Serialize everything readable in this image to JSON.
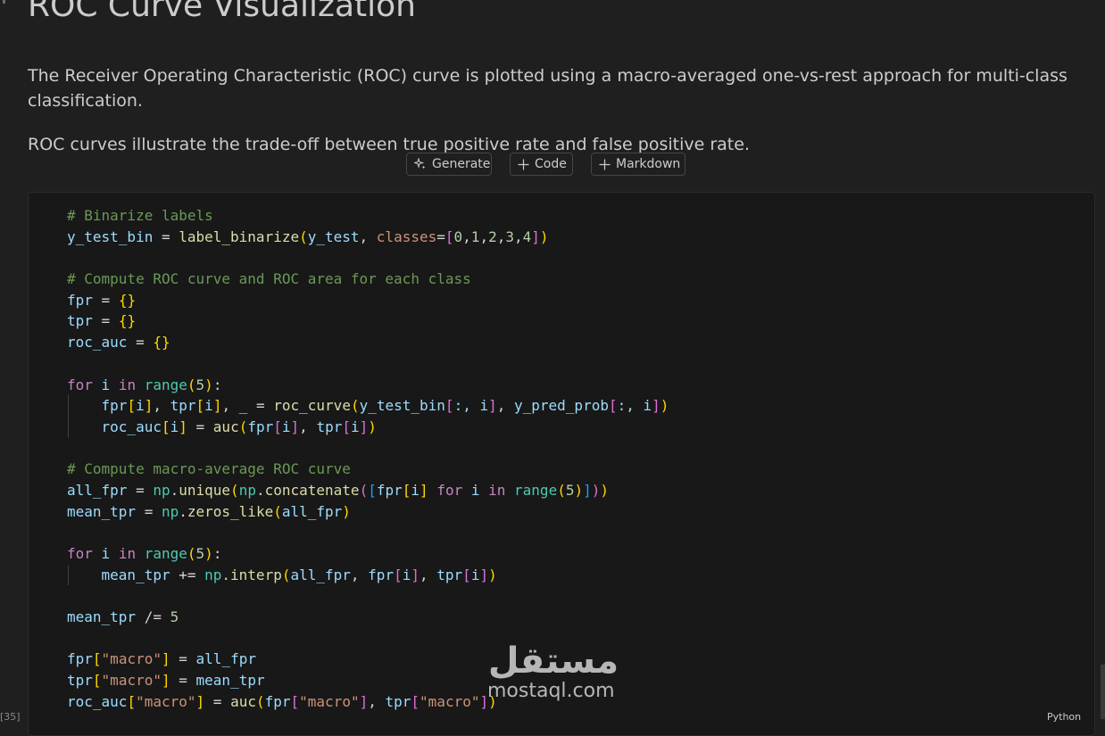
{
  "markdown": {
    "title": "ROC Curve Visualization",
    "paragraph1": "The Receiver Operating Characteristic (ROC) curve is plotted using a macro-averaged one-vs-rest approach for multi-class classification.",
    "paragraph2": "ROC curves illustrate the trade-off between true positive rate and false positive rate."
  },
  "toolbar": {
    "generate_label": "Generate",
    "code_label": "Code",
    "markdown_label": "Markdown"
  },
  "code_cell": {
    "execution_count": "[35]",
    "language": "Python",
    "lines": [
      {
        "indent": 0,
        "tokens": [
          {
            "t": "# Binarize labels",
            "c": "cm"
          }
        ]
      },
      {
        "indent": 0,
        "tokens": [
          {
            "t": "y_test_bin",
            "c": "vr"
          },
          {
            "t": " = ",
            "c": "op"
          },
          {
            "t": "label_binarize",
            "c": "fn"
          },
          {
            "t": "(",
            "c": "b1"
          },
          {
            "t": "y_test",
            "c": "vr"
          },
          {
            "t": ", ",
            "c": "op"
          },
          {
            "t": "classes",
            "c": "st"
          },
          {
            "t": "=",
            "c": "op"
          },
          {
            "t": "[",
            "c": "b2"
          },
          {
            "t": "0",
            "c": "nm"
          },
          {
            "t": ",",
            "c": "op"
          },
          {
            "t": "1",
            "c": "nm"
          },
          {
            "t": ",",
            "c": "op"
          },
          {
            "t": "2",
            "c": "nm"
          },
          {
            "t": ",",
            "c": "op"
          },
          {
            "t": "3",
            "c": "nm"
          },
          {
            "t": ",",
            "c": "op"
          },
          {
            "t": "4",
            "c": "nm"
          },
          {
            "t": "]",
            "c": "b2"
          },
          {
            "t": ")",
            "c": "b1"
          }
        ]
      },
      {
        "indent": 0,
        "tokens": []
      },
      {
        "indent": 0,
        "tokens": [
          {
            "t": "# Compute ROC curve and ROC area for each class",
            "c": "cm"
          }
        ]
      },
      {
        "indent": 0,
        "tokens": [
          {
            "t": "fpr",
            "c": "vr"
          },
          {
            "t": " = ",
            "c": "op"
          },
          {
            "t": "{}",
            "c": "b1"
          }
        ]
      },
      {
        "indent": 0,
        "tokens": [
          {
            "t": "tpr",
            "c": "vr"
          },
          {
            "t": " = ",
            "c": "op"
          },
          {
            "t": "{}",
            "c": "b1"
          }
        ]
      },
      {
        "indent": 0,
        "tokens": [
          {
            "t": "roc_auc",
            "c": "vr"
          },
          {
            "t": " = ",
            "c": "op"
          },
          {
            "t": "{}",
            "c": "b1"
          }
        ]
      },
      {
        "indent": 0,
        "tokens": []
      },
      {
        "indent": 0,
        "tokens": [
          {
            "t": "for",
            "c": "kw"
          },
          {
            "t": " i ",
            "c": "vr"
          },
          {
            "t": "in",
            "c": "kw"
          },
          {
            "t": " ",
            "c": "op"
          },
          {
            "t": "range",
            "c": "bi"
          },
          {
            "t": "(",
            "c": "b1"
          },
          {
            "t": "5",
            "c": "nm"
          },
          {
            "t": ")",
            "c": "b1"
          },
          {
            "t": ":",
            "c": "op"
          }
        ]
      },
      {
        "indent": 1,
        "tokens": [
          {
            "t": "fpr",
            "c": "vr"
          },
          {
            "t": "[",
            "c": "b1"
          },
          {
            "t": "i",
            "c": "vr"
          },
          {
            "t": "]",
            "c": "b1"
          },
          {
            "t": ", ",
            "c": "op"
          },
          {
            "t": "tpr",
            "c": "vr"
          },
          {
            "t": "[",
            "c": "b1"
          },
          {
            "t": "i",
            "c": "vr"
          },
          {
            "t": "]",
            "c": "b1"
          },
          {
            "t": ", _ = ",
            "c": "op"
          },
          {
            "t": "roc_curve",
            "c": "fn"
          },
          {
            "t": "(",
            "c": "b1"
          },
          {
            "t": "y_test_bin",
            "c": "vr"
          },
          {
            "t": "[",
            "c": "b2"
          },
          {
            "t": ":, i",
            "c": "vr"
          },
          {
            "t": "]",
            "c": "b2"
          },
          {
            "t": ", ",
            "c": "op"
          },
          {
            "t": "y_pred_prob",
            "c": "vr"
          },
          {
            "t": "[",
            "c": "b2"
          },
          {
            "t": ":, i",
            "c": "vr"
          },
          {
            "t": "]",
            "c": "b2"
          },
          {
            "t": ")",
            "c": "b1"
          }
        ]
      },
      {
        "indent": 1,
        "tokens": [
          {
            "t": "roc_auc",
            "c": "vr"
          },
          {
            "t": "[",
            "c": "b1"
          },
          {
            "t": "i",
            "c": "vr"
          },
          {
            "t": "]",
            "c": "b1"
          },
          {
            "t": " = ",
            "c": "op"
          },
          {
            "t": "auc",
            "c": "fn"
          },
          {
            "t": "(",
            "c": "b1"
          },
          {
            "t": "fpr",
            "c": "vr"
          },
          {
            "t": "[",
            "c": "b2"
          },
          {
            "t": "i",
            "c": "vr"
          },
          {
            "t": "]",
            "c": "b2"
          },
          {
            "t": ", ",
            "c": "op"
          },
          {
            "t": "tpr",
            "c": "vr"
          },
          {
            "t": "[",
            "c": "b2"
          },
          {
            "t": "i",
            "c": "vr"
          },
          {
            "t": "]",
            "c": "b2"
          },
          {
            "t": ")",
            "c": "b1"
          }
        ]
      },
      {
        "indent": 0,
        "tokens": []
      },
      {
        "indent": 0,
        "tokens": [
          {
            "t": "# Compute macro-average ROC curve",
            "c": "cm"
          }
        ]
      },
      {
        "indent": 0,
        "tokens": [
          {
            "t": "all_fpr",
            "c": "vr"
          },
          {
            "t": " = ",
            "c": "op"
          },
          {
            "t": "np",
            "c": "mo"
          },
          {
            "t": ".",
            "c": "op"
          },
          {
            "t": "unique",
            "c": "fn"
          },
          {
            "t": "(",
            "c": "b1"
          },
          {
            "t": "np",
            "c": "mo"
          },
          {
            "t": ".",
            "c": "op"
          },
          {
            "t": "concatenate",
            "c": "fn"
          },
          {
            "t": "(",
            "c": "b2"
          },
          {
            "t": "[",
            "c": "b3"
          },
          {
            "t": "fpr",
            "c": "vr"
          },
          {
            "t": "[",
            "c": "b1"
          },
          {
            "t": "i",
            "c": "vr"
          },
          {
            "t": "]",
            "c": "b1"
          },
          {
            "t": " ",
            "c": "op"
          },
          {
            "t": "for",
            "c": "kw"
          },
          {
            "t": " i ",
            "c": "vr"
          },
          {
            "t": "in",
            "c": "kw"
          },
          {
            "t": " ",
            "c": "op"
          },
          {
            "t": "range",
            "c": "bi"
          },
          {
            "t": "(",
            "c": "b1"
          },
          {
            "t": "5",
            "c": "nm"
          },
          {
            "t": ")",
            "c": "b1"
          },
          {
            "t": "]",
            "c": "b3"
          },
          {
            "t": ")",
            "c": "b2"
          },
          {
            "t": ")",
            "c": "b1"
          }
        ]
      },
      {
        "indent": 0,
        "tokens": [
          {
            "t": "mean_tpr",
            "c": "vr"
          },
          {
            "t": " = ",
            "c": "op"
          },
          {
            "t": "np",
            "c": "mo"
          },
          {
            "t": ".",
            "c": "op"
          },
          {
            "t": "zeros_like",
            "c": "fn"
          },
          {
            "t": "(",
            "c": "b1"
          },
          {
            "t": "all_fpr",
            "c": "vr"
          },
          {
            "t": ")",
            "c": "b1"
          }
        ]
      },
      {
        "indent": 0,
        "tokens": []
      },
      {
        "indent": 0,
        "tokens": [
          {
            "t": "for",
            "c": "kw"
          },
          {
            "t": " i ",
            "c": "vr"
          },
          {
            "t": "in",
            "c": "kw"
          },
          {
            "t": " ",
            "c": "op"
          },
          {
            "t": "range",
            "c": "bi"
          },
          {
            "t": "(",
            "c": "b1"
          },
          {
            "t": "5",
            "c": "nm"
          },
          {
            "t": ")",
            "c": "b1"
          },
          {
            "t": ":",
            "c": "op"
          }
        ]
      },
      {
        "indent": 1,
        "tokens": [
          {
            "t": "mean_tpr",
            "c": "vr"
          },
          {
            "t": " += ",
            "c": "op"
          },
          {
            "t": "np",
            "c": "mo"
          },
          {
            "t": ".",
            "c": "op"
          },
          {
            "t": "interp",
            "c": "fn"
          },
          {
            "t": "(",
            "c": "b1"
          },
          {
            "t": "all_fpr",
            "c": "vr"
          },
          {
            "t": ", ",
            "c": "op"
          },
          {
            "t": "fpr",
            "c": "vr"
          },
          {
            "t": "[",
            "c": "b2"
          },
          {
            "t": "i",
            "c": "vr"
          },
          {
            "t": "]",
            "c": "b2"
          },
          {
            "t": ", ",
            "c": "op"
          },
          {
            "t": "tpr",
            "c": "vr"
          },
          {
            "t": "[",
            "c": "b2"
          },
          {
            "t": "i",
            "c": "vr"
          },
          {
            "t": "]",
            "c": "b2"
          },
          {
            "t": ")",
            "c": "b1"
          }
        ]
      },
      {
        "indent": 0,
        "tokens": []
      },
      {
        "indent": 0,
        "tokens": [
          {
            "t": "mean_tpr",
            "c": "vr"
          },
          {
            "t": " /= ",
            "c": "op"
          },
          {
            "t": "5",
            "c": "nm"
          }
        ]
      },
      {
        "indent": 0,
        "tokens": []
      },
      {
        "indent": 0,
        "tokens": [
          {
            "t": "fpr",
            "c": "vr"
          },
          {
            "t": "[",
            "c": "b1"
          },
          {
            "t": "\"macro\"",
            "c": "st"
          },
          {
            "t": "]",
            "c": "b1"
          },
          {
            "t": " = ",
            "c": "op"
          },
          {
            "t": "all_fpr",
            "c": "vr"
          }
        ]
      },
      {
        "indent": 0,
        "tokens": [
          {
            "t": "tpr",
            "c": "vr"
          },
          {
            "t": "[",
            "c": "b1"
          },
          {
            "t": "\"macro\"",
            "c": "st"
          },
          {
            "t": "]",
            "c": "b1"
          },
          {
            "t": " = ",
            "c": "op"
          },
          {
            "t": "mean_tpr",
            "c": "vr"
          }
        ]
      },
      {
        "indent": 0,
        "tokens": [
          {
            "t": "roc_auc",
            "c": "vr"
          },
          {
            "t": "[",
            "c": "b1"
          },
          {
            "t": "\"macro\"",
            "c": "st"
          },
          {
            "t": "]",
            "c": "b1"
          },
          {
            "t": " = ",
            "c": "op"
          },
          {
            "t": "auc",
            "c": "fn"
          },
          {
            "t": "(",
            "c": "b1"
          },
          {
            "t": "fpr",
            "c": "vr"
          },
          {
            "t": "[",
            "c": "b2"
          },
          {
            "t": "\"macro\"",
            "c": "st"
          },
          {
            "t": "]",
            "c": "b2"
          },
          {
            "t": ", ",
            "c": "op"
          },
          {
            "t": "tpr",
            "c": "vr"
          },
          {
            "t": "[",
            "c": "b2"
          },
          {
            "t": "\"macro\"",
            "c": "st"
          },
          {
            "t": "]",
            "c": "b2"
          },
          {
            "t": ")",
            "c": "b1"
          }
        ]
      }
    ]
  },
  "watermark": {
    "arabic": "مستقل",
    "latin": "mostaql.com"
  }
}
